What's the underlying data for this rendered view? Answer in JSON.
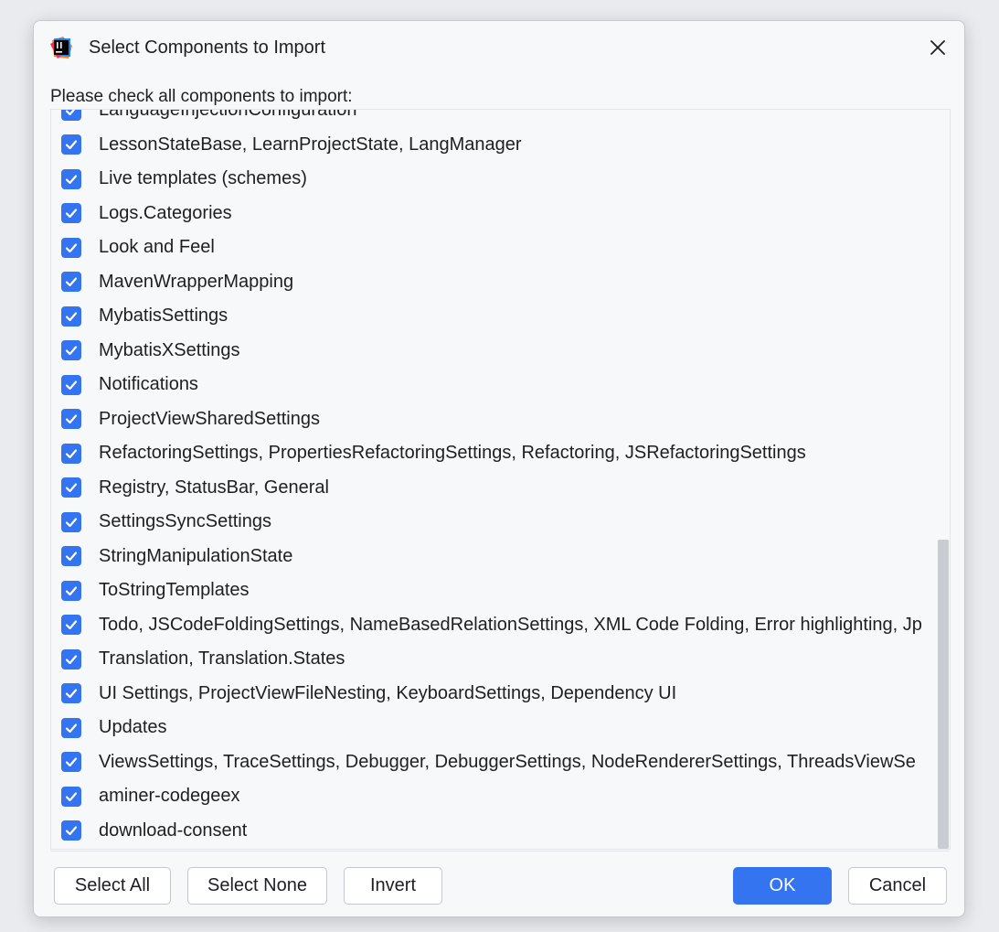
{
  "dialog": {
    "title": "Select Components to Import",
    "instruction": "Please check all components to import:"
  },
  "components": [
    {
      "label": "LanguageInjectionConfiguration",
      "checked": true
    },
    {
      "label": "LessonStateBase, LearnProjectState, LangManager",
      "checked": true
    },
    {
      "label": "Live templates (schemes)",
      "checked": true
    },
    {
      "label": "Logs.Categories",
      "checked": true
    },
    {
      "label": "Look and Feel",
      "checked": true
    },
    {
      "label": "MavenWrapperMapping",
      "checked": true
    },
    {
      "label": "MybatisSettings",
      "checked": true
    },
    {
      "label": "MybatisXSettings",
      "checked": true
    },
    {
      "label": "Notifications",
      "checked": true
    },
    {
      "label": "ProjectViewSharedSettings",
      "checked": true
    },
    {
      "label": "RefactoringSettings, PropertiesRefactoringSettings, Refactoring, JSRefactoringSettings",
      "checked": true
    },
    {
      "label": "Registry, StatusBar, General",
      "checked": true
    },
    {
      "label": "SettingsSyncSettings",
      "checked": true
    },
    {
      "label": "StringManipulationState",
      "checked": true
    },
    {
      "label": "ToStringTemplates",
      "checked": true
    },
    {
      "label": "Todo, JSCodeFoldingSettings, NameBasedRelationSettings, XML Code Folding, Error highlighting, Jp",
      "checked": true
    },
    {
      "label": "Translation, Translation.States",
      "checked": true
    },
    {
      "label": "UI Settings, ProjectViewFileNesting, KeyboardSettings, Dependency UI",
      "checked": true
    },
    {
      "label": "Updates",
      "checked": true
    },
    {
      "label": "ViewsSettings, TraceSettings, Debugger, DebuggerSettings, NodeRendererSettings, ThreadsViewSe",
      "checked": true
    },
    {
      "label": "aminer-codegeex",
      "checked": true
    },
    {
      "label": "download-consent",
      "checked": true
    }
  ],
  "buttons": {
    "select_all": "Select All",
    "select_none": "Select None",
    "invert": "Invert",
    "ok": "OK",
    "cancel": "Cancel"
  },
  "icons": {
    "app": "intellij-app-icon",
    "close": "close-icon",
    "check": "checkmark-icon"
  },
  "colors": {
    "accent": "#3574f0",
    "background": "#f7f8fa",
    "text": "#1e1f22"
  }
}
